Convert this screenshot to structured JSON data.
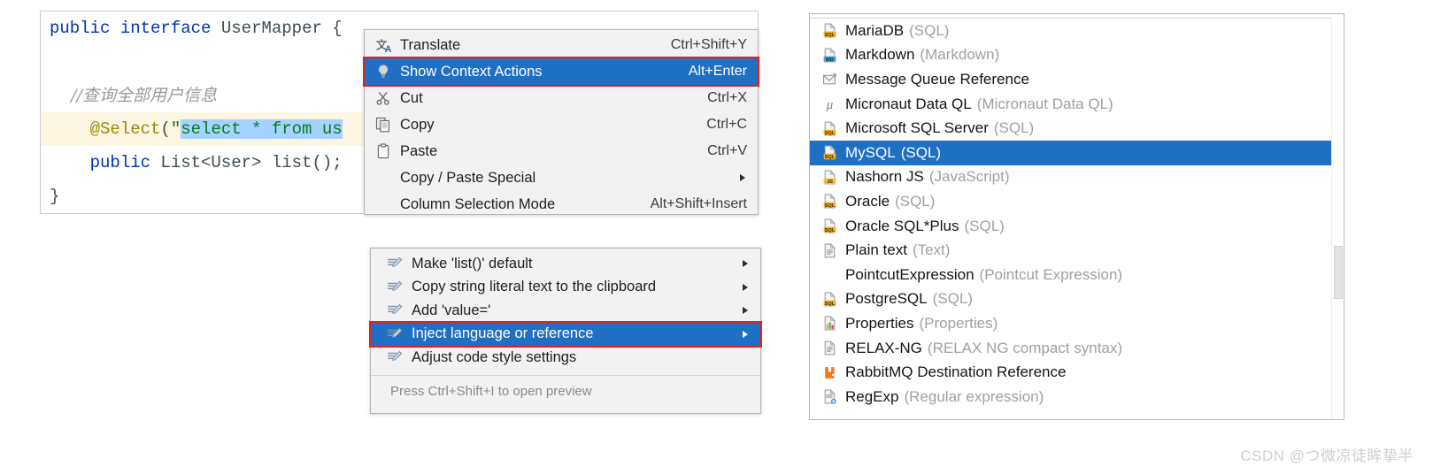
{
  "editor": {
    "lines": [
      {
        "id": "l1",
        "parts": [
          {
            "t": "public ",
            "c": "kw"
          },
          {
            "t": "interface ",
            "c": "kw"
          },
          {
            "t": "UserMapper ",
            "c": "cls"
          },
          {
            "t": "{",
            "c": "punc"
          }
        ]
      },
      {
        "id": "l2",
        "parts": []
      },
      {
        "id": "l3",
        "parts": [
          {
            "t": "    //查询全部用户信息",
            "c": "cmt"
          }
        ]
      },
      {
        "id": "l4",
        "highlight": true,
        "parts": [
          {
            "t": "    @Select",
            "c": "ann"
          },
          {
            "t": "(",
            "c": "punc"
          },
          {
            "t": "\"",
            "c": "str-q"
          },
          {
            "t": "select * from us",
            "c": "sel"
          }
        ]
      },
      {
        "id": "l5",
        "parts": [
          {
            "t": "    public ",
            "c": "kw"
          },
          {
            "t": "List<User> ",
            "c": "plain"
          },
          {
            "t": "list",
            "c": "plain"
          },
          {
            "t": "();",
            "c": "punc"
          }
        ]
      },
      {
        "id": "l6",
        "parts": [
          {
            "t": "}",
            "c": "punc"
          }
        ]
      }
    ]
  },
  "context_menu": {
    "items": [
      {
        "label": "Translate",
        "accel": "Ctrl+Shift+Y",
        "icon": "translate-icon",
        "arrow": false,
        "highlighted": false
      },
      {
        "label": "Show Context Actions",
        "accel": "Alt+Enter",
        "icon": "lightbulb-icon",
        "arrow": false,
        "highlighted": true,
        "redbox": true
      },
      {
        "label": "Cut",
        "accel": "Ctrl+X",
        "icon": "scissors-icon",
        "arrow": false,
        "highlighted": false,
        "mnemonic": "t"
      },
      {
        "label": "Copy",
        "accel": "Ctrl+C",
        "icon": "copy-icon",
        "arrow": false,
        "highlighted": false,
        "mnemonic": "C"
      },
      {
        "label": "Paste",
        "accel": "Ctrl+V",
        "icon": "clipboard-icon",
        "arrow": false,
        "highlighted": false,
        "mnemonic": "P"
      },
      {
        "label": "Copy / Paste Special",
        "accel": "",
        "icon": "none",
        "arrow": true,
        "highlighted": false
      },
      {
        "label": "Column Selection Mode",
        "accel": "Alt+Shift+Insert",
        "icon": "none",
        "arrow": false,
        "highlighted": false,
        "mnemonic": "M"
      }
    ]
  },
  "inject_menu": {
    "items": [
      {
        "label": "Make 'list()' default",
        "icon": "intention-icon",
        "arrow": true,
        "highlighted": false
      },
      {
        "label": "Copy string literal text to the clipboard",
        "icon": "intention-icon",
        "arrow": true,
        "highlighted": false
      },
      {
        "label": "Add 'value='",
        "icon": "intention-icon",
        "arrow": true,
        "highlighted": false
      },
      {
        "label": "Inject language or reference",
        "icon": "intention-icon",
        "arrow": true,
        "highlighted": true,
        "redbox": true
      },
      {
        "label": "Adjust code style settings",
        "icon": "intention-icon",
        "arrow": false,
        "highlighted": false
      }
    ],
    "hint": "Press Ctrl+Shift+I to open preview"
  },
  "language_list": {
    "items": [
      {
        "name": "MariaDB",
        "paren": "(SQL)",
        "icon": "sql-file-icon",
        "selected": false
      },
      {
        "name": "Markdown",
        "paren": "(Markdown)",
        "icon": "md-file-icon",
        "selected": false
      },
      {
        "name": "Message Queue Reference",
        "paren": "",
        "icon": "envelope-icon",
        "selected": false
      },
      {
        "name": "Micronaut Data QL",
        "paren": "(Micronaut Data QL)",
        "icon": "mu-icon",
        "selected": false
      },
      {
        "name": "Microsoft SQL Server",
        "paren": "(SQL)",
        "icon": "sql-file-icon",
        "selected": false
      },
      {
        "name": "MySQL",
        "paren": "(SQL)",
        "icon": "sql-file-icon",
        "selected": true
      },
      {
        "name": "Nashorn JS",
        "paren": "(JavaScript)",
        "icon": "js-file-icon",
        "selected": false
      },
      {
        "name": "Oracle",
        "paren": "(SQL)",
        "icon": "sql-file-icon",
        "selected": false
      },
      {
        "name": "Oracle SQL*Plus",
        "paren": "(SQL)",
        "icon": "sql-file-icon",
        "selected": false
      },
      {
        "name": "Plain text",
        "paren": "(Text)",
        "icon": "text-file-icon",
        "selected": false
      },
      {
        "name": "PointcutExpression",
        "paren": "(Pointcut Expression)",
        "icon": "none",
        "selected": false
      },
      {
        "name": "PostgreSQL",
        "paren": "(SQL)",
        "icon": "sql-file-icon",
        "selected": false
      },
      {
        "name": "Properties",
        "paren": "(Properties)",
        "icon": "properties-icon",
        "selected": false
      },
      {
        "name": "RELAX-NG",
        "paren": "(RELAX NG compact syntax)",
        "icon": "text-file-icon",
        "selected": false
      },
      {
        "name": "RabbitMQ Destination Reference",
        "paren": "",
        "icon": "rabbitmq-icon",
        "selected": false
      },
      {
        "name": "RegExp",
        "paren": "(Regular expression)",
        "icon": "regexp-file-icon",
        "selected": false
      }
    ]
  },
  "watermark": {
    "text": "CSDN @つ微凉徒眸挚半"
  },
  "colors": {
    "selection_blue": "#1f6fc4",
    "highlight_red": "#ee1b1b",
    "menu_bg": "#f2f2f2",
    "code_keyword": "#0033b3",
    "code_string": "#067d17",
    "code_annotation": "#9e880d",
    "code_selection": "#a6d2ff"
  }
}
